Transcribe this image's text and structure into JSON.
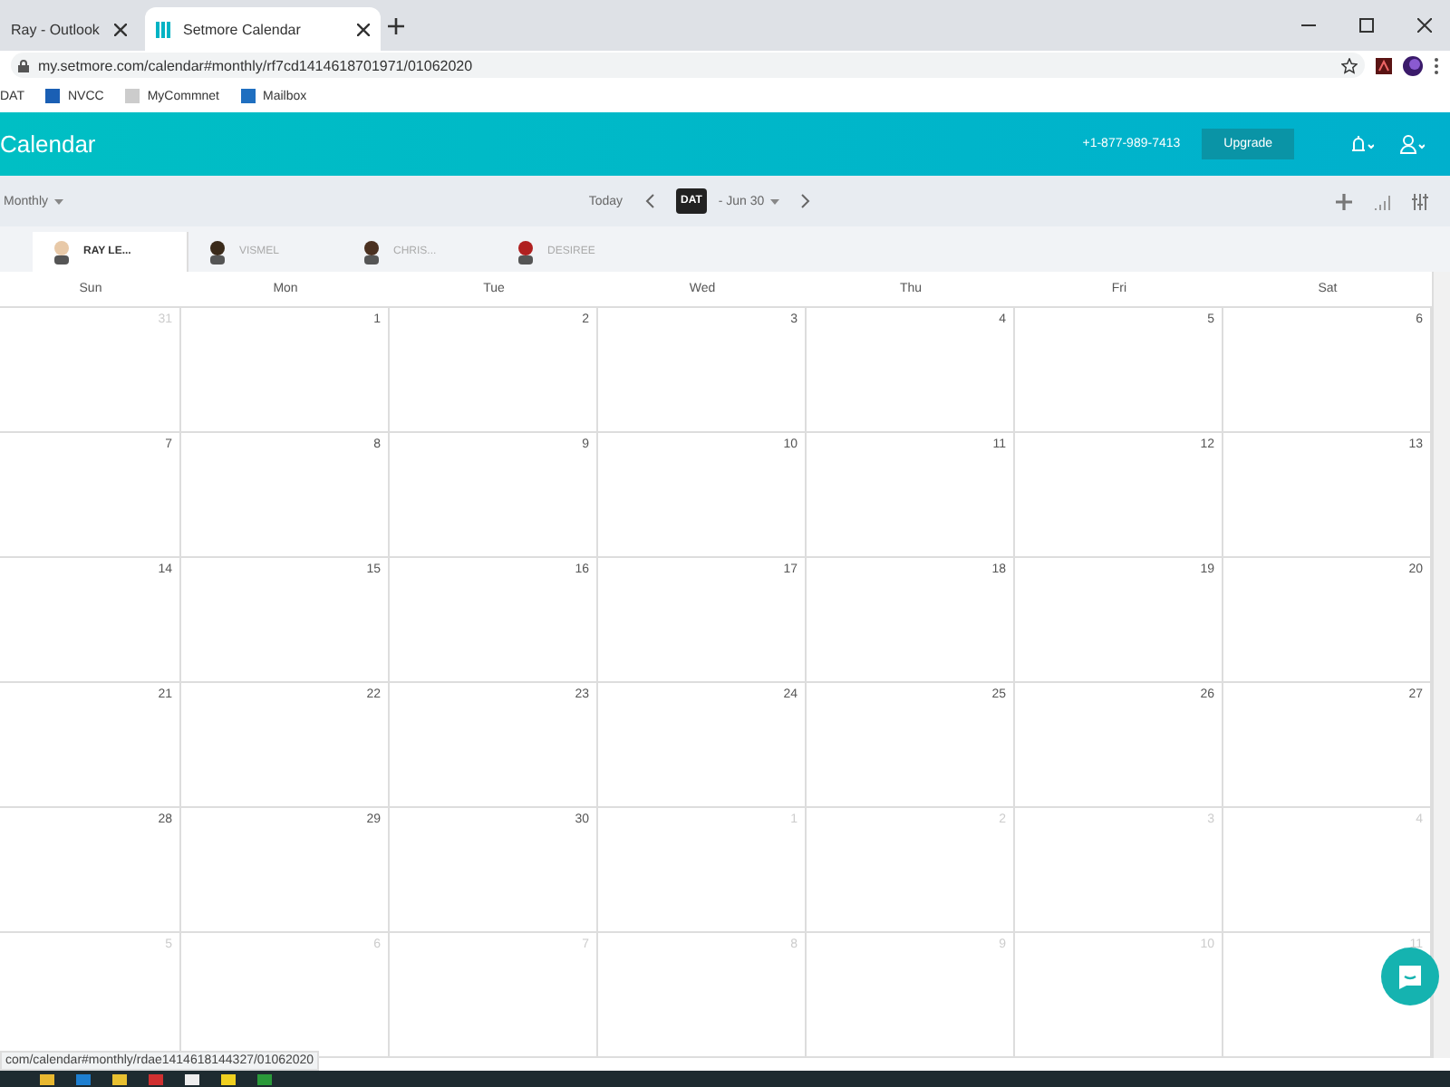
{
  "browser": {
    "tabs": [
      {
        "title": "Ray - Outlook",
        "selected": false
      },
      {
        "title": "Setmore Calendar",
        "selected": true
      }
    ],
    "url": "my.setmore.com/calendar#monthly/rf7cd1414618701971/01062020",
    "bookmarks": [
      "DAT",
      "NVCC",
      "MyCommnet",
      "Mailbox"
    ],
    "status_url": "com/calendar#monthly/rdae1414618144327/01062020"
  },
  "header": {
    "title": "Calendar",
    "phone": "+1-877-989-7413",
    "upgrade": "Upgrade"
  },
  "toolbar": {
    "view": "Monthly",
    "today": "Today",
    "date_range": "- Jun 30",
    "tooltip": "DAT"
  },
  "staff": [
    {
      "name": "RAY LE...",
      "selected": true
    },
    {
      "name": "VISMEL",
      "selected": false
    },
    {
      "name": "CHRIS...",
      "selected": false
    },
    {
      "name": "DESIREE",
      "selected": false
    }
  ],
  "weekdays": [
    "Sun",
    "Mon",
    "Tue",
    "Wed",
    "Thu",
    "Fri",
    "Sat"
  ],
  "weeks": [
    [
      {
        "day": "31",
        "muted": true
      },
      {
        "day": "1",
        "muted": false
      },
      {
        "day": "2",
        "muted": false
      },
      {
        "day": "3",
        "muted": false
      },
      {
        "day": "4",
        "muted": false
      },
      {
        "day": "5",
        "muted": false
      },
      {
        "day": "6",
        "muted": false
      }
    ],
    [
      {
        "day": "7",
        "muted": false
      },
      {
        "day": "8",
        "muted": false
      },
      {
        "day": "9",
        "muted": false
      },
      {
        "day": "10",
        "muted": false
      },
      {
        "day": "11",
        "muted": false
      },
      {
        "day": "12",
        "muted": false
      },
      {
        "day": "13",
        "muted": false
      }
    ],
    [
      {
        "day": "14",
        "muted": false
      },
      {
        "day": "15",
        "muted": false
      },
      {
        "day": "16",
        "muted": false
      },
      {
        "day": "17",
        "muted": false
      },
      {
        "day": "18",
        "muted": false
      },
      {
        "day": "19",
        "muted": false
      },
      {
        "day": "20",
        "muted": false
      }
    ],
    [
      {
        "day": "21",
        "muted": false
      },
      {
        "day": "22",
        "muted": false
      },
      {
        "day": "23",
        "muted": false
      },
      {
        "day": "24",
        "muted": false
      },
      {
        "day": "25",
        "muted": false
      },
      {
        "day": "26",
        "muted": false
      },
      {
        "day": "27",
        "muted": false
      }
    ],
    [
      {
        "day": "28",
        "muted": false
      },
      {
        "day": "29",
        "muted": false
      },
      {
        "day": "30",
        "muted": false
      },
      {
        "day": "1",
        "muted": true
      },
      {
        "day": "2",
        "muted": true
      },
      {
        "day": "3",
        "muted": true
      },
      {
        "day": "4",
        "muted": true
      }
    ],
    [
      {
        "day": "5",
        "muted": true
      },
      {
        "day": "6",
        "muted": true
      },
      {
        "day": "7",
        "muted": true
      },
      {
        "day": "8",
        "muted": true
      },
      {
        "day": "9",
        "muted": true
      },
      {
        "day": "10",
        "muted": true
      },
      {
        "day": "11",
        "muted": true
      }
    ]
  ]
}
